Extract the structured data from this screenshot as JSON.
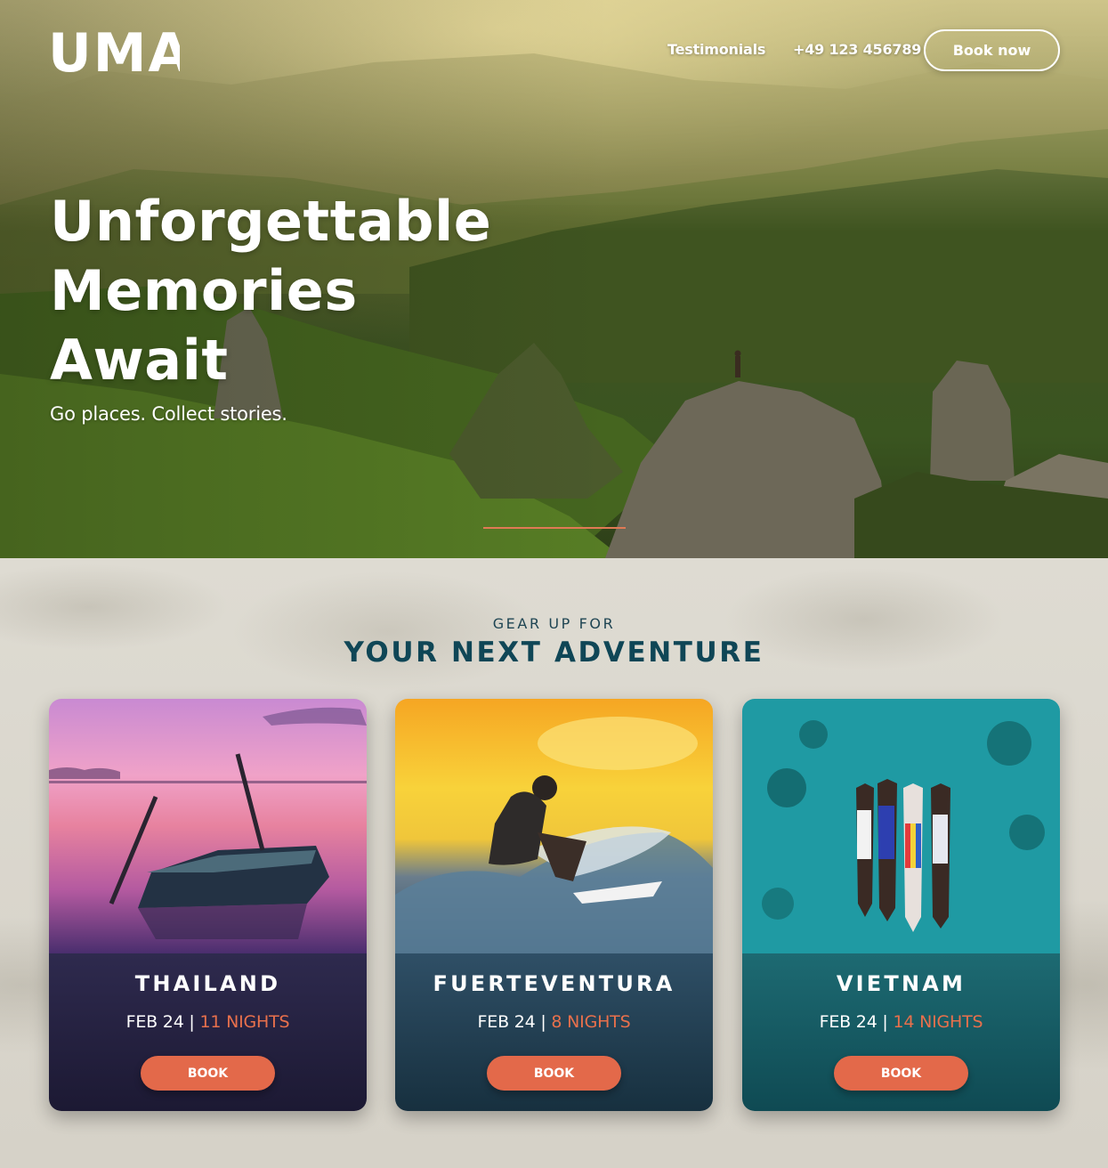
{
  "brand": {
    "logo_text": "UMA"
  },
  "nav": {
    "testimonials": "Testimonials",
    "phone": "+49 123 456789",
    "book_now": "Book now"
  },
  "hero": {
    "title_line1": "Unforgettable",
    "title_line2": "Memories",
    "title_line3": "Await",
    "subtitle": "Go places. Collect stories."
  },
  "section": {
    "eyebrow": "GEAR UP FOR",
    "title": "YOUR NEXT ADVENTURE"
  },
  "trips": [
    {
      "name": "THAILAND",
      "date": "FEB 24 |",
      "nights": "11 NIGHTS",
      "button": "BOOK"
    },
    {
      "name": "FUERTEVENTURA",
      "date": "FEB 24 |",
      "nights": "8 NIGHTS",
      "button": "BOOK"
    },
    {
      "name": "VIETNAM",
      "date": "FEB 24 |",
      "nights": "14 NIGHTS",
      "button": "BOOK"
    }
  ],
  "colors": {
    "accent": "#e3694a",
    "heading": "#0f4656"
  }
}
